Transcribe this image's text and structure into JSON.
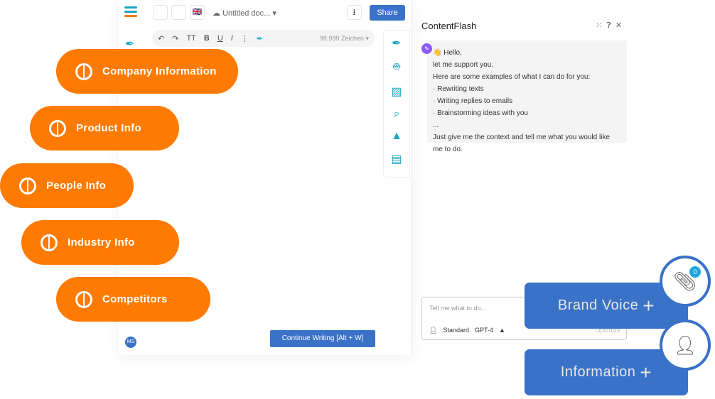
{
  "header": {
    "document_title": "Untitled doc...",
    "share_label": "Share",
    "flag": "🇬🇧"
  },
  "toolbar": {
    "undo": "↶",
    "redo": "↷",
    "text_size": "TT",
    "bold": "B",
    "underline": "U",
    "italic": "I",
    "more": "⋮",
    "char_count": "99.999 Zeichen ▾"
  },
  "editor": {
    "continue_label": "Continue Writing  [Alt + W]",
    "user_initials": "MS"
  },
  "chat": {
    "title": "ContentFlash",
    "lines": [
      "👋 Hello,",
      "let me support you.",
      "Here are some examples of what I can do for you:",
      "· Rewriting texts",
      "· Writing replies to emails",
      "· Brainstorming ideas with you",
      "...",
      "Just give me the context and tell me what you would like me to do."
    ],
    "input_placeholder": "Tell me what to do...",
    "mode": "Standard",
    "model": "GPT-4",
    "optimize": "Optimize"
  },
  "pills": [
    {
      "label": "Company Information"
    },
    {
      "label": "Product Info"
    },
    {
      "label": "People Info"
    },
    {
      "label": "Industry Info"
    },
    {
      "label": "Competitors"
    }
  ],
  "buttons": {
    "brand_voice": "Brand Voice",
    "information": "Information",
    "attachment_count": "0"
  },
  "colors": {
    "orange": "#ff7a00",
    "blue": "#3a72c8",
    "teal": "#1aa6c4"
  }
}
